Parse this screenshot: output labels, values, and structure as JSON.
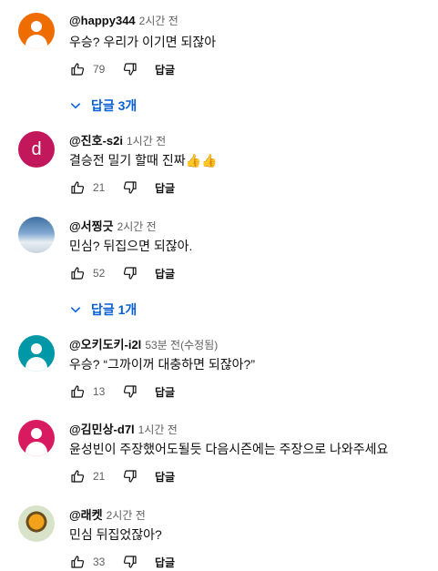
{
  "comments": [
    {
      "author": "@happy344",
      "time": "2시간 전",
      "text": "우승? 우리가 이기면 되잖아",
      "likes": "79",
      "reply_label": "답글",
      "replies_label": "답글 3개",
      "avatar_color": "#ef6c00"
    },
    {
      "author": "@진호-s2i",
      "time": "1시간 전",
      "text": "결승전 밀기 할때 진짜👍👍",
      "likes": "21",
      "reply_label": "답글",
      "avatar_letter": "d",
      "avatar_color": "#c2185b"
    },
    {
      "author": "@서찡긋",
      "time": "2시간 전",
      "text": "민심? 뒤집으면 되잖아.",
      "likes": "52",
      "reply_label": "답글",
      "replies_label": "답글 1개"
    },
    {
      "author": "@오키도키-i2l",
      "time": "53분 전(수정됨)",
      "text": "우승? “그까이꺼 대충하면 되잖아?”",
      "likes": "13",
      "reply_label": "답글",
      "avatar_color": "#0097a7"
    },
    {
      "author": "@김민상-d7l",
      "time": "1시간 전",
      "text": "윤성빈이 주장했어도될듯 다음시즌에는 주장으로 나와주세요",
      "likes": "21",
      "reply_label": "답글",
      "avatar_color": "#d81b60"
    },
    {
      "author": "@래켓",
      "time": "2시간 전",
      "text": "민심 뒤집었잖아?",
      "likes": "33",
      "reply_label": "답글"
    }
  ],
  "colors": {
    "link": "#065fd4",
    "secondary_text": "#606060"
  }
}
